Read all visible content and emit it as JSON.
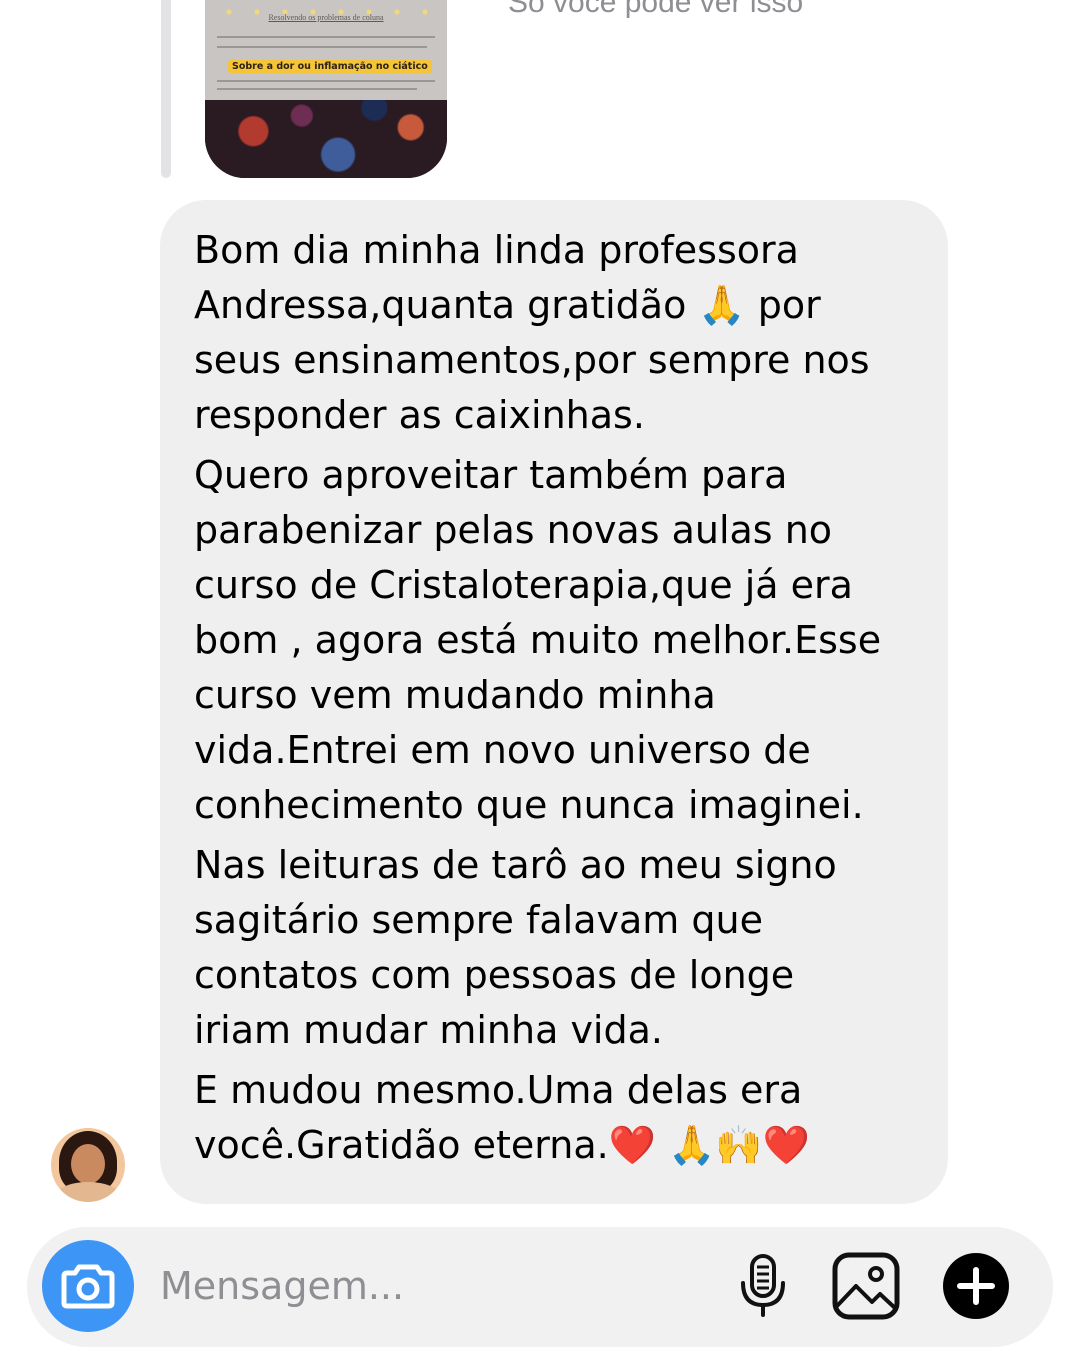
{
  "story_reply": {
    "note": "Só você pode ver isso",
    "thumbnail": {
      "title": "Resolvendo os problemas de coluna",
      "highlight": "Sobre a dor ou inflamação no ciático"
    }
  },
  "message": {
    "paragraphs": [
      "Bom dia minha linda professora\nAndressa,quanta gratidão 🙏 por\nseus ensinamentos,por sempre nos\nresponder as caixinhas.",
      "Quero aproveitar também para\nparabenizar pelas novas aulas no\ncurso de Cristaloterapia,que já era\nbom , agora está muito melhor.Esse\ncurso vem mudando minha\nvida.Entrei em novo universo de\nconhecimento que nunca imaginei.",
      "Nas leituras de tarô ao meu signo\nsagitário sempre falavam  que\ncontatos com pessoas de longe\niriam mudar minha vida.",
      "E mudou mesmo.Uma delas era\nvocê.Gratidão eterna.❤️ 🙏🙌❤️"
    ]
  },
  "composer": {
    "placeholder": "Mensagem...",
    "value": ""
  },
  "icons": {
    "camera": "camera-icon",
    "mic": "microphone-icon",
    "gallery": "gallery-icon",
    "plus": "plus-icon"
  },
  "colors": {
    "camera_button": "#3d96f5",
    "bubble": "#efefef",
    "composer": "#f1f1f1",
    "muted_text": "#8e8e93"
  }
}
